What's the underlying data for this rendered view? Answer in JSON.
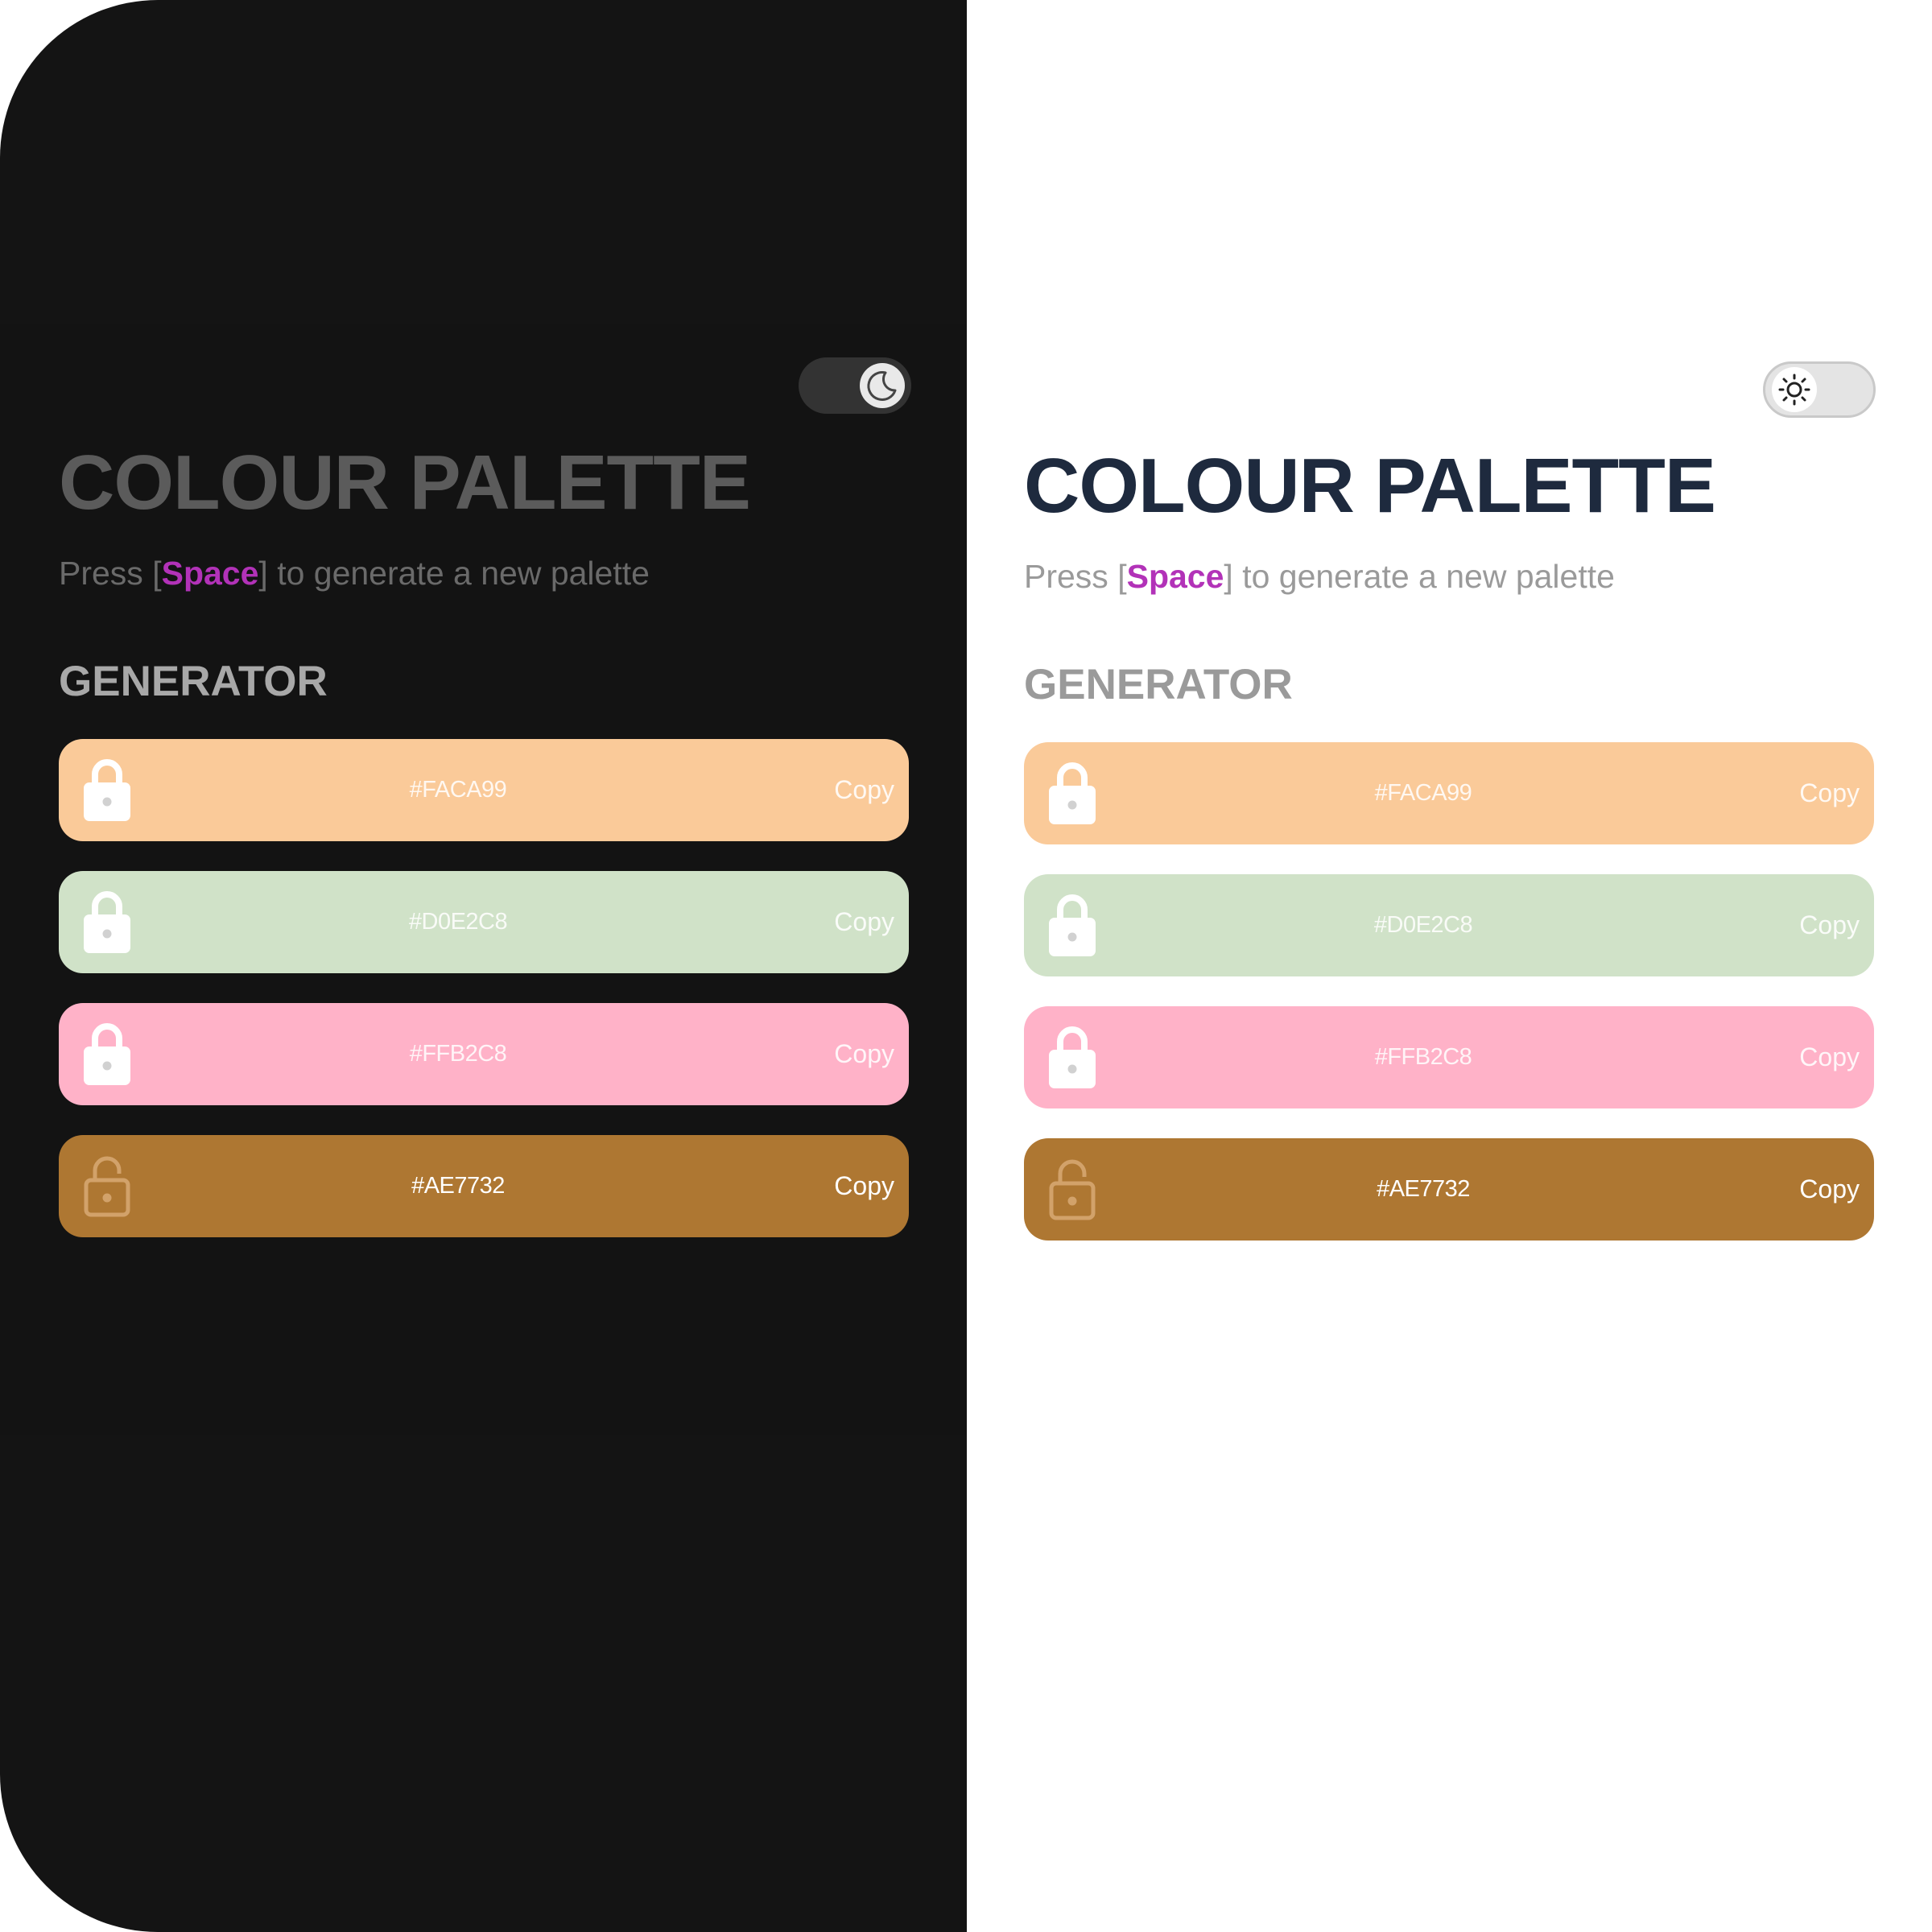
{
  "dark": {
    "title": "COLOUR PALETTE",
    "subtitle_prefix": "Press [",
    "subtitle_key": "Space",
    "subtitle_suffix": "] to generate a new palette",
    "section": "GENERATOR",
    "toggle_icon": "moon-icon",
    "colors": [
      {
        "hex": "#FACA99",
        "copy": "Copy",
        "locked": true,
        "lock_color": "#ffffff"
      },
      {
        "hex": "#D0E2C8",
        "copy": "Copy",
        "locked": true,
        "lock_color": "#ffffff"
      },
      {
        "hex": "#FFB2C8",
        "copy": "Copy",
        "locked": true,
        "lock_color": "#ffffff"
      },
      {
        "hex": "#AE7732",
        "copy": "Copy",
        "locked": false,
        "lock_color": "#d2a26a"
      }
    ]
  },
  "light": {
    "title": "COLOUR PALETTE",
    "subtitle_prefix": "Press [",
    "subtitle_key": "Space",
    "subtitle_suffix": "] to generate a new palette",
    "section": "GENERATOR",
    "toggle_icon": "sun-icon",
    "colors": [
      {
        "hex": "#FACA99",
        "copy": "Copy",
        "locked": true,
        "lock_color": "#ffffff"
      },
      {
        "hex": "#D0E2C8",
        "copy": "Copy",
        "locked": true,
        "lock_color": "#ffffff"
      },
      {
        "hex": "#FFB2C8",
        "copy": "Copy",
        "locked": true,
        "lock_color": "#ffffff"
      },
      {
        "hex": "#AE7732",
        "copy": "Copy",
        "locked": false,
        "lock_color": "#d2a26a"
      }
    ]
  },
  "colors": {
    "dark_background": "#141414",
    "light_background": "#ffffff",
    "accent": "#b232b8",
    "light_title": "#1e2a3e"
  }
}
